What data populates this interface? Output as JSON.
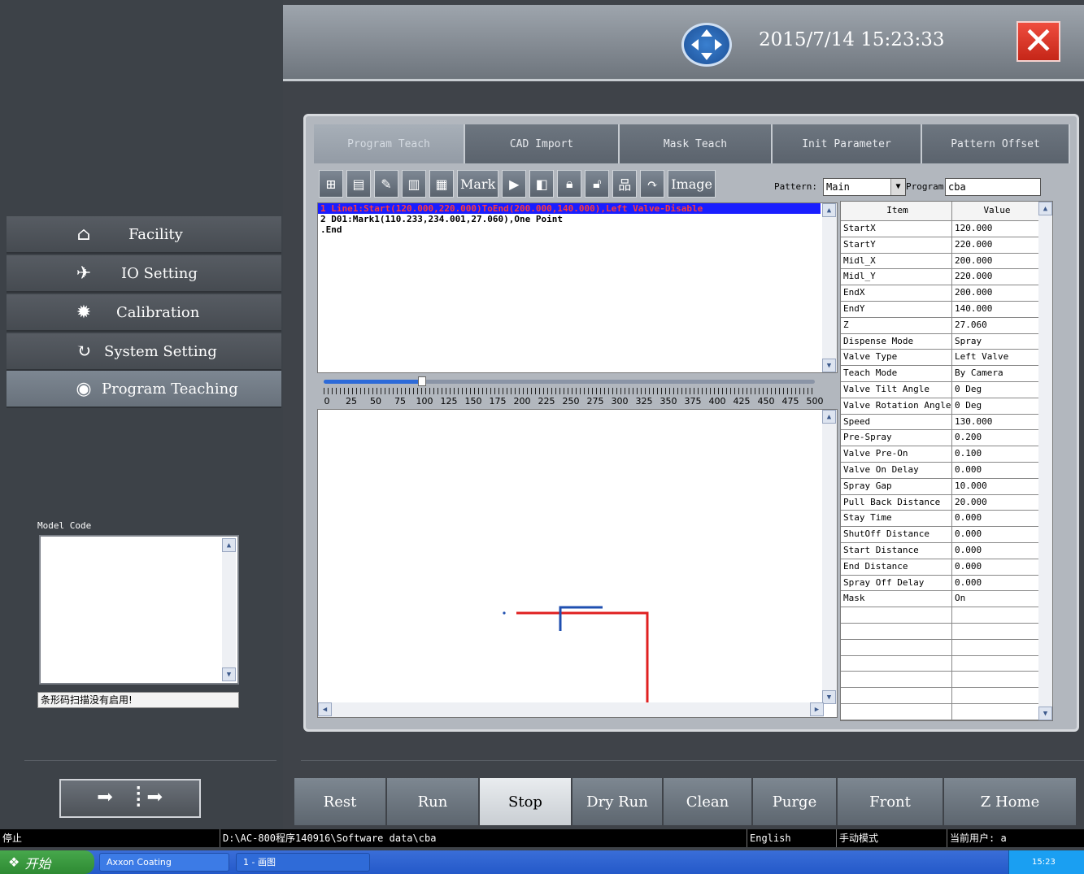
{
  "header": {
    "datetime": "2015/7/14 15:23:33"
  },
  "sidebar": {
    "items": [
      {
        "label": "Facility",
        "icon": "home-icon"
      },
      {
        "label": "IO Setting",
        "icon": "pin-icon"
      },
      {
        "label": "Calibration",
        "icon": "gear-icon"
      },
      {
        "label": "System Setting",
        "icon": "refresh-icon"
      },
      {
        "label": "Program Teaching",
        "icon": "eye-icon"
      }
    ],
    "active": "Program Teaching",
    "model_code_label": "Model Code",
    "barcode_status": "条形码扫描没有启用!"
  },
  "tabs": [
    {
      "label": "Program Teach",
      "active": true
    },
    {
      "label": "CAD Import"
    },
    {
      "label": "Mask Teach"
    },
    {
      "label": "Init Parameter"
    },
    {
      "label": "Pattern Offset"
    }
  ],
  "toolbar": {
    "mark_label": "Mark",
    "image_label": "Image",
    "pattern_label": "Pattern:",
    "pattern_value": "Main",
    "program_label": "Program:",
    "program_value": "cba"
  },
  "code_lines": [
    "1 Line1:Start(120.000,220.000)ToEnd(200.000,140.000),Left Valve-Disable",
    "2 D01:Mark1(110.233,234.001,27.060),One Point",
    ".End"
  ],
  "ruler": {
    "value": 100,
    "min": 0,
    "max": 500,
    "labels": [
      "0",
      "25",
      "50",
      "75",
      "100",
      "125",
      "150",
      "175",
      "200",
      "225",
      "250",
      "275",
      "300",
      "325",
      "350",
      "375",
      "400",
      "425",
      "450",
      "475",
      "500"
    ]
  },
  "params": {
    "headers": [
      "Item",
      "Value"
    ],
    "rows": [
      [
        "StartX",
        "120.000"
      ],
      [
        "StartY",
        "220.000"
      ],
      [
        "Midl_X",
        "200.000"
      ],
      [
        "Midl_Y",
        "220.000"
      ],
      [
        "EndX",
        "200.000"
      ],
      [
        "EndY",
        "140.000"
      ],
      [
        "Z",
        "27.060"
      ],
      [
        "Dispense Mode",
        "Spray"
      ],
      [
        "Valve Type",
        "Left Valve"
      ],
      [
        "Teach Mode",
        "By Camera"
      ],
      [
        "Valve Tilt Angle",
        "0 Deg"
      ],
      [
        "Valve Rotation Angle",
        "0 Deg"
      ],
      [
        "Speed",
        "130.000"
      ],
      [
        "Pre-Spray",
        "0.200"
      ],
      [
        "Valve Pre-On",
        "0.100"
      ],
      [
        "Valve On Delay",
        "0.000"
      ],
      [
        "Spray Gap",
        "10.000"
      ],
      [
        "Pull Back Distance",
        "20.000"
      ],
      [
        "Stay Time",
        "0.000"
      ],
      [
        "ShutOff Distance",
        "0.000"
      ],
      [
        "Start Distance",
        "0.000"
      ],
      [
        "End Distance",
        "0.000"
      ],
      [
        "Spray Off Delay",
        "0.000"
      ],
      [
        "Mask",
        "On"
      ],
      [
        "",
        ""
      ],
      [
        "",
        ""
      ],
      [
        "",
        ""
      ],
      [
        "",
        ""
      ],
      [
        "",
        ""
      ],
      [
        "",
        ""
      ],
      [
        "",
        ""
      ]
    ]
  },
  "actions": [
    {
      "label": "Rest"
    },
    {
      "label": "Run"
    },
    {
      "label": "Stop",
      "active": true
    },
    {
      "label": "Dry Run"
    },
    {
      "label": "Clean"
    },
    {
      "label": "Purge"
    },
    {
      "label": "Front"
    },
    {
      "label": "Z Home"
    }
  ],
  "status": {
    "state": "停止",
    "path": "D:\\AC-800程序140916\\Software data\\cba",
    "language": "English",
    "mode": "手动模式",
    "user": "当前用户: a"
  },
  "taskbar": {
    "start": "开始",
    "tasks": [
      "Axxon Coating",
      "1 - 画图"
    ],
    "time": "15:23"
  },
  "colors": {
    "path_red": "#e02020",
    "path_blue": "#1f4fb0",
    "selected_row": "#1a1eff"
  }
}
